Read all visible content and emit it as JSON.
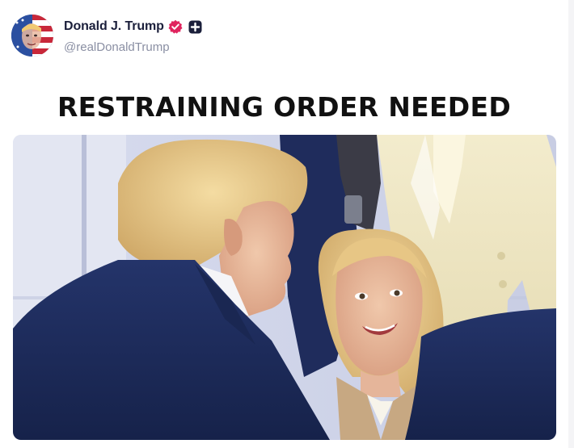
{
  "post": {
    "author": {
      "display_name": "Donald J. Trump",
      "handle": "@realDonaldTrump",
      "verified": true,
      "verified_color": "#e0245e",
      "avatar_icon": "avatar-portrait-flag"
    },
    "headline": "RESTRAINING ORDER NEEDED",
    "media": {
      "type": "photo",
      "icon": "photo-two-people-conversation"
    }
  }
}
